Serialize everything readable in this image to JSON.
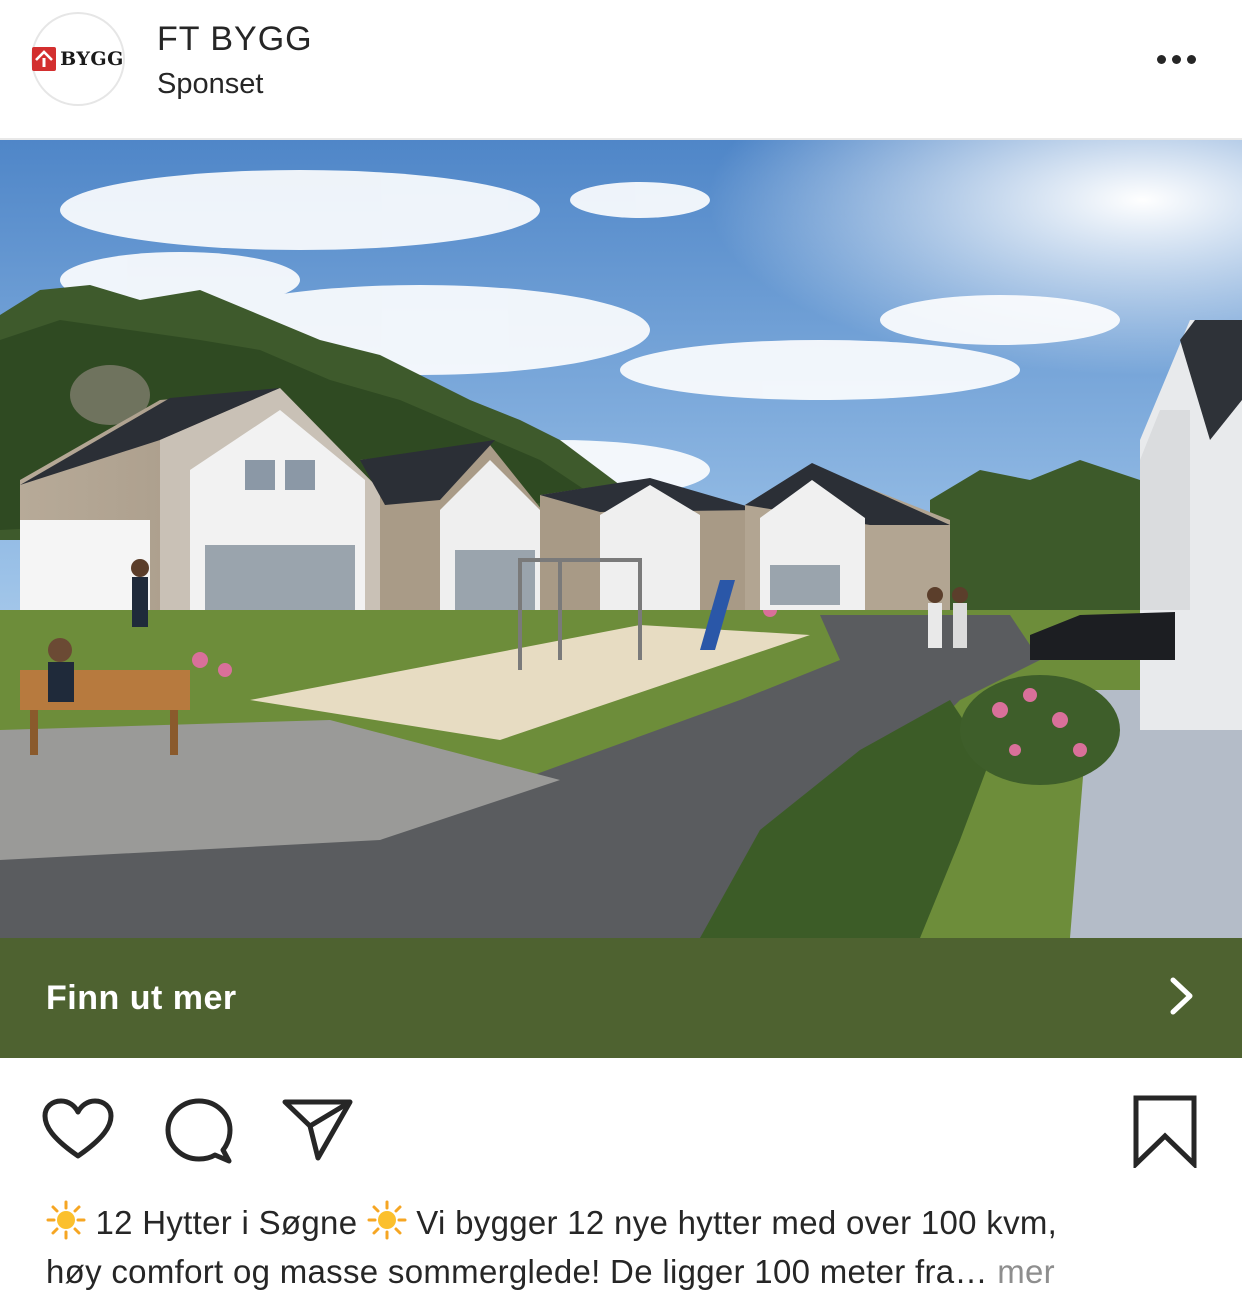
{
  "post": {
    "account_name": "FT BYGG",
    "sponsored_label": "Sponset",
    "avatar_logo_text": "BYGG",
    "cta_label": "Finn ut mer",
    "caption_part1": "12 Hytter i Søgne",
    "caption_part2": "Vi bygger 12 nye hytter med over 100 kvm,",
    "caption_line2": "høy comfort og masse sommerglede! De ligger 100 meter fra…",
    "more_label": "mer"
  },
  "icons": {
    "more_options": "more-options-icon",
    "cta_arrow": "chevron-right-icon",
    "like": "heart-icon",
    "comment": "comment-icon",
    "share": "paper-plane-icon",
    "save": "bookmark-icon",
    "emoji": "sun-emoji-icon"
  },
  "colors": {
    "cta_background": "#4e6230",
    "logo_red": "#d32f2f",
    "text": "#262626",
    "muted": "#8e8e8e"
  }
}
